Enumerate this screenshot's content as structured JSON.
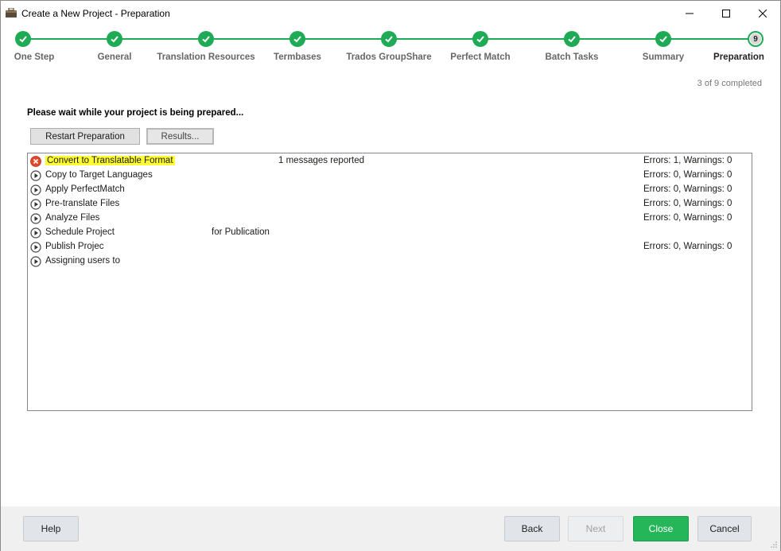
{
  "window": {
    "title": "Create a New Project - Preparation",
    "icon": "briefcase-icon"
  },
  "stepper": {
    "accent_color": "#1faa55",
    "steps": [
      {
        "label": "One Step",
        "done": true
      },
      {
        "label": "General",
        "done": true
      },
      {
        "label": "Translation Resources",
        "done": true
      },
      {
        "label": "Termbases",
        "done": true
      },
      {
        "label": "Trados GroupShare",
        "done": true
      },
      {
        "label": "Perfect Match",
        "done": true
      },
      {
        "label": "Batch Tasks",
        "done": true
      },
      {
        "label": "Summary",
        "done": true
      },
      {
        "label": "Preparation",
        "done": false,
        "number": "9"
      }
    ],
    "progress_text": "3 of 9 completed"
  },
  "main": {
    "wait_text": "Please wait while your project is being prepared...",
    "restart_label": "Restart Preparation",
    "results_label": "Results...",
    "tasks": [
      {
        "name": "Convert to Translatable Format",
        "status_icon": "error-icon",
        "message": "1 messages reported",
        "result": "Errors: 1, Warnings: 0",
        "highlight": true
      },
      {
        "name": "Copy to Target Languages",
        "status_icon": "play-icon",
        "message": "",
        "result": "Errors: 0, Warnings: 0"
      },
      {
        "name": "Apply PerfectMatch",
        "status_icon": "play-icon",
        "message": "",
        "result": "Errors: 0, Warnings: 0"
      },
      {
        "name": "Pre-translate Files",
        "status_icon": "play-icon",
        "message": "",
        "result": "Errors: 0, Warnings: 0"
      },
      {
        "name": "Analyze Files",
        "status_icon": "play-icon",
        "message": "",
        "result": "Errors: 0, Warnings: 0"
      },
      {
        "name": "Schedule Project",
        "status_icon": "play-icon",
        "message": "for Publication",
        "result": ""
      },
      {
        "name": "Publish Projec",
        "status_icon": "play-icon",
        "message": "",
        "result": "Errors: 0, Warnings: 0"
      },
      {
        "name": "Assigning users to",
        "status_icon": "play-icon",
        "message": "",
        "result": ""
      }
    ]
  },
  "footer": {
    "help_label": "Help",
    "back_label": "Back",
    "next_label": "Next",
    "close_label": "Close",
    "cancel_label": "Cancel"
  }
}
